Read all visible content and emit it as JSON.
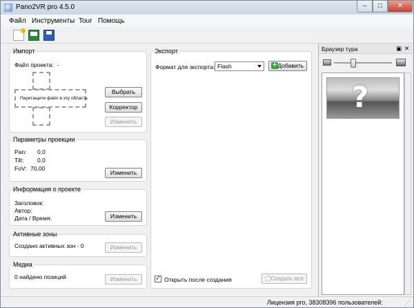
{
  "window": {
    "title": "Pano2VR pro 4.5.0",
    "min_glyph": "–",
    "max_glyph": "□",
    "close_glyph": "✕"
  },
  "menu": {
    "file": "Файл",
    "tools": "Инструменты",
    "tour": "Tour",
    "help": "Помощь"
  },
  "import": {
    "title": "Импорт",
    "project_file_label": "Файл проекта:",
    "project_file_value": "-",
    "drop_hint": "Перетащите файл в эту область",
    "choose_button": "Выбрать",
    "corrector_button": "Корректор",
    "change_button": "Изменить"
  },
  "projection": {
    "title": "Параметры проекции",
    "pan_label": "Pan:",
    "pan_value": "0,0",
    "tilt_label": "Tilt:",
    "tilt_value": "0,0",
    "fov_label": "FoV:",
    "fov_value": "70,00",
    "change_button": "Изменить"
  },
  "project_info": {
    "title": "Информация о проекте",
    "heading_label": "Заголовок:",
    "author_label": "Автор:",
    "datetime_label": "Дата / Время:",
    "change_button": "Изменить"
  },
  "hotspots": {
    "title": "Активные зоны",
    "created_text": "Создано активных зон - 0",
    "change_button": "Изменить"
  },
  "media": {
    "title": "Медиа",
    "found_text": "0 найдено позиций",
    "change_button": "Изменить"
  },
  "export": {
    "title": "Экспорт",
    "format_label": "Формат для экспорта:",
    "format_value": "Flash",
    "add_button": "Добавить",
    "open_after_label": "Открыть после создания",
    "open_after_checked": true,
    "create_all_button": "Создать все"
  },
  "tour_browser": {
    "title": "Браузер тура",
    "float_glyph": "▣",
    "close_glyph": "✕",
    "thumb_glyph": "?"
  },
  "status": {
    "license_text": "Лицензия pro, 38308396 пользователей:"
  }
}
